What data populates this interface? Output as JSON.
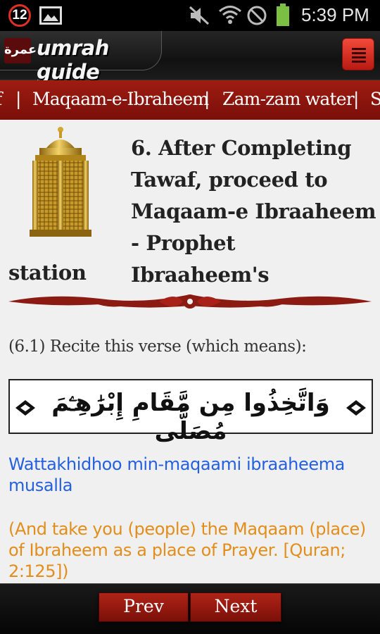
{
  "status_bar": {
    "notification_count": "12",
    "time": "5:39 PM",
    "icons": [
      "gallery-icon",
      "mute-icon",
      "wifi-icon",
      "do-not-disturb-icon",
      "battery-icon"
    ]
  },
  "header": {
    "logo_text": "عمرة",
    "title": "umrah guide",
    "menu_icon": "menu-icon"
  },
  "topic_nav": {
    "items": [
      {
        "label": "f"
      },
      {
        "label": "Maqaam-e-Ibraheem"
      },
      {
        "label": "Zam-zam water"
      },
      {
        "label": "S"
      }
    ],
    "separator": "|"
  },
  "content": {
    "title_main": "6. After Completing Tawaf, proceed to Maqaam-e Ibraaheem - Prophet Ibraaheem's",
    "title_tail": "station",
    "instruction": "(6.1) Recite this verse (which means):",
    "verse_arabic": "وَاتَّخِذُوا مِن مَّقَامِ إِبْرَٰهِـۧمَ مُصَلًّى",
    "transliteration": "Wattakhidhoo min-maqaami ibraaheema musalla",
    "translation": "(And take you (people) the Maqaam (place) of Ibraheem as a place of Prayer. [Quran; 2:125])"
  },
  "bottom_nav": {
    "prev_label": "Prev",
    "next_label": "Next"
  },
  "colors": {
    "accent_red": "#9e1c12",
    "transliteration_blue": "#2460e0",
    "translation_orange": "#e38d1a"
  }
}
